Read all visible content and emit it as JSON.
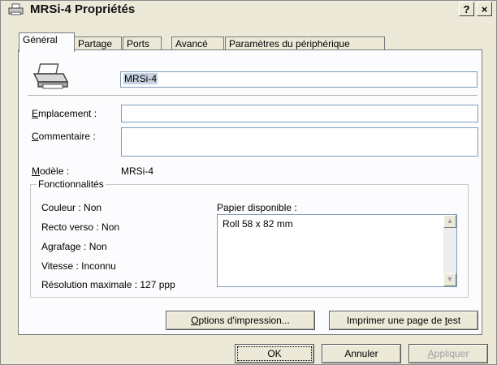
{
  "window": {
    "title": "MRSi-4 Propriétés",
    "help": "?",
    "close": "×"
  },
  "tabs": [
    {
      "label": "Général",
      "active": true
    },
    {
      "label": "Partage"
    },
    {
      "label": "Ports"
    },
    {
      "label": "Avancé"
    },
    {
      "label": "Paramètres du périphérique"
    }
  ],
  "general": {
    "printer_name": "MRSi-4",
    "location_label_u": "E",
    "location_label_rest": "mplacement :",
    "location_value": "",
    "comment_label_u": "C",
    "comment_label_rest": "ommentaire :",
    "comment_value": "",
    "model_label_u": "M",
    "model_label_rest": "odèle :",
    "model_value": "MRSi-4"
  },
  "features": {
    "title": "Fonctionnalités",
    "color": "Couleur : Non",
    "duplex": "Recto verso : Non",
    "staple": "Agrafage : Non",
    "speed": "Vitesse : Inconnu",
    "resolution": "Résolution maximale : 127 ppp",
    "paper_label": "Papier disponible :",
    "paper_items": [
      "Roll 58 x 82 mm"
    ]
  },
  "buttons": {
    "print_options_u": "O",
    "print_options_rest": "ptions d'impression...",
    "test_page_pre": "Imprimer une page de ",
    "test_page_u": "t",
    "test_page_post": "est",
    "ok": "OK",
    "cancel": "Annuler",
    "apply_u": "A",
    "apply_rest": "ppliquer"
  },
  "icons": {
    "printer": "printer-icon",
    "title_printer": "printer-small-icon"
  }
}
